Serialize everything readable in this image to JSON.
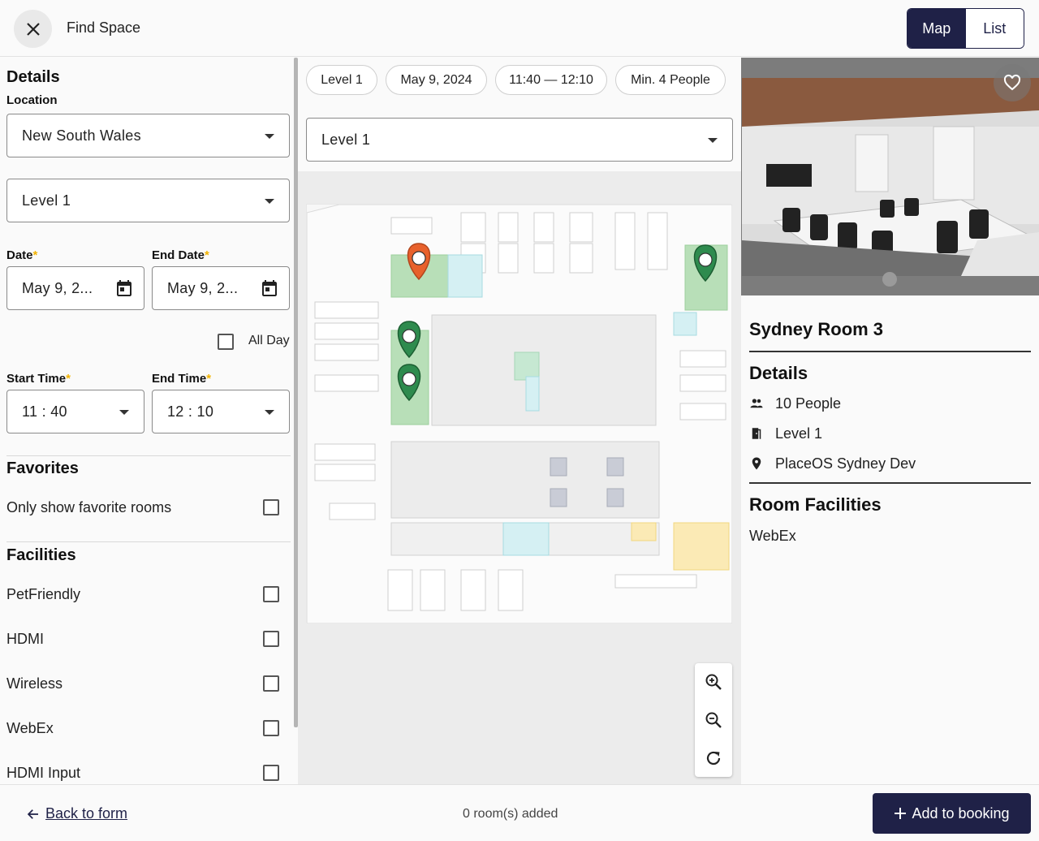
{
  "header": {
    "title": "Find Space",
    "view_map": "Map",
    "view_list": "List",
    "active_view": "Map"
  },
  "filters": {
    "details_heading": "Details",
    "location_label": "Location",
    "location_value": "New South Wales",
    "level_value": "Level 1",
    "date_label": "Date",
    "date_value": "May 9, 2...",
    "end_date_label": "End Date",
    "end_date_value": "May 9, 2...",
    "all_day_label": "All Day",
    "all_day_checked": false,
    "start_time_label": "Start Time",
    "start_time_value": "11 : 40",
    "end_time_label": "End Time",
    "end_time_value": "12 : 10",
    "required_marker": "*",
    "favorites_heading": "Favorites",
    "only_favorites_label": "Only show favorite rooms",
    "facilities_heading": "Facilities",
    "facilities": [
      {
        "label": "PetFriendly",
        "checked": false
      },
      {
        "label": "HDMI",
        "checked": false
      },
      {
        "label": "Wireless",
        "checked": false
      },
      {
        "label": "WebEx",
        "checked": false
      },
      {
        "label": "HDMI Input",
        "checked": false
      }
    ]
  },
  "map": {
    "chips": [
      "Level 1",
      "May 9, 2024",
      "11:40 — 12:10",
      "Min. 4 People"
    ],
    "level_select": "Level 1",
    "marker_colors": {
      "selected": "#e8612c",
      "available": "#2e8b4e"
    }
  },
  "room": {
    "name": "Sydney Room 3",
    "details_heading": "Details",
    "capacity": "10 People",
    "level": "Level 1",
    "building": "PlaceOS Sydney Dev",
    "facilities_heading": "Room Facilities",
    "facilities": "WebEx"
  },
  "footer": {
    "back_label": "Back to form",
    "rooms_added": "0 room(s) added",
    "add_label": "Add to booking"
  },
  "colors": {
    "primary": "#1f2147",
    "required": "#f2b300"
  }
}
